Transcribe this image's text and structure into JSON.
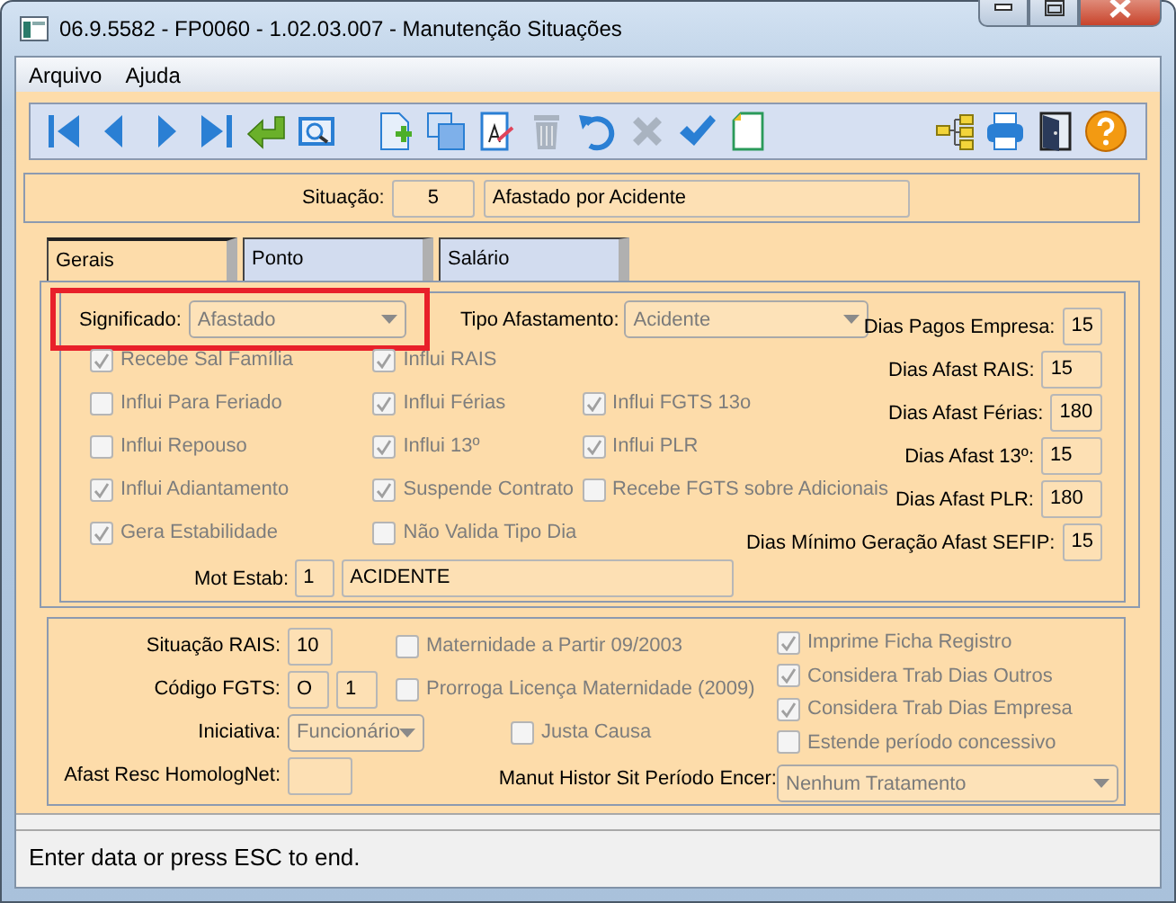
{
  "window": {
    "title": "06.9.5582 - FP0060 - 1.02.03.007 - Manutenção Situações"
  },
  "menu": [
    {
      "label": "Arquivo"
    },
    {
      "label": "Ajuda"
    }
  ],
  "toolbar": {
    "left": [
      {
        "kind": "first",
        "disabled": false
      },
      {
        "kind": "prev",
        "disabled": false
      },
      {
        "kind": "next",
        "disabled": false
      },
      {
        "kind": "last",
        "disabled": false
      },
      {
        "kind": "enter",
        "disabled": false
      },
      {
        "kind": "preview",
        "disabled": false
      },
      {
        "kind": "new",
        "disabled": false
      },
      {
        "kind": "copy",
        "disabled": false
      },
      {
        "kind": "edit",
        "disabled": false
      },
      {
        "kind": "delete",
        "disabled": true
      },
      {
        "kind": "undo",
        "disabled": false
      },
      {
        "kind": "cancel",
        "disabled": true
      },
      {
        "kind": "confirm",
        "disabled": false
      },
      {
        "kind": "note",
        "disabled": false
      }
    ],
    "right": [
      {
        "kind": "tree",
        "disabled": false
      },
      {
        "kind": "print",
        "disabled": false
      },
      {
        "kind": "exit",
        "disabled": false
      },
      {
        "kind": "help",
        "disabled": false
      }
    ]
  },
  "situacao": {
    "label": "Situação:",
    "code": "5",
    "description": "Afastado por Acidente"
  },
  "tabs": [
    {
      "label": "Gerais",
      "selected": true
    },
    {
      "label": "Ponto",
      "selected": false
    },
    {
      "label": "Salário",
      "selected": false
    }
  ],
  "gerais": {
    "significado": {
      "label": "Significado:",
      "value": "Afastado",
      "disabled": true,
      "highlighted": true
    },
    "tipo_afastamento": {
      "label": "Tipo Afastamento:",
      "value": "Acidente",
      "disabled": true
    },
    "checkbox_columns": [
      [
        {
          "label": "Recebe Sal Família",
          "checked": true,
          "disabled": true
        },
        {
          "label": "Influi Para Feriado",
          "checked": false,
          "disabled": true
        },
        {
          "label": "Influi Repouso",
          "checked": false,
          "disabled": true
        },
        {
          "label": "Influi Adiantamento",
          "checked": true,
          "disabled": true
        },
        {
          "label": "Gera Estabilidade",
          "checked": true,
          "disabled": true
        }
      ],
      [
        {
          "label": "Influi RAIS",
          "checked": true,
          "disabled": true
        },
        {
          "label": "Influi Férias",
          "checked": true,
          "disabled": true
        },
        {
          "label": "Influi 13º",
          "checked": true,
          "disabled": true
        },
        {
          "label": "Suspende Contrato",
          "checked": true,
          "disabled": true
        },
        {
          "label": "Não Valida Tipo Dia",
          "checked": false,
          "disabled": true
        }
      ],
      [
        {
          "label": "Influi FGTS 13o",
          "checked": true,
          "disabled": true
        },
        {
          "label": "Influi PLR",
          "checked": true,
          "disabled": true
        },
        {
          "label": "Recebe FGTS sobre Adicionais",
          "checked": false,
          "disabled": true
        }
      ]
    ],
    "day_fields": [
      {
        "label": "Dias Pagos Empresa:",
        "value": "15"
      },
      {
        "label": "Dias Afast RAIS:",
        "value": "15"
      },
      {
        "label": "Dias Afast Férias:",
        "value": "180"
      },
      {
        "label": "Dias Afast 13º:",
        "value": "15"
      },
      {
        "label": "Dias Afast PLR:",
        "value": "180"
      },
      {
        "label": "Dias Mínimo Geração Afast SEFIP:",
        "value": "15"
      }
    ],
    "mot_estab": {
      "label": "Mot Estab:",
      "code": "1",
      "description": "ACIDENTE"
    }
  },
  "lower": {
    "situacao_rais": {
      "label": "Situação RAIS:",
      "value": "10"
    },
    "codigo_fgts": {
      "label": "Código FGTS:",
      "values": [
        "O",
        "1"
      ]
    },
    "iniciativa": {
      "label": "Iniciativa:",
      "value": "Funcionário",
      "disabled": true
    },
    "afast_resc_homolognet": {
      "label": "Afast Resc HomologNet:"
    },
    "middle_checkboxes": [
      {
        "label": "Maternidade a Partir 09/2003",
        "checked": false,
        "disabled": true
      },
      {
        "label": "Prorroga Licença Maternidade (2009)",
        "checked": false,
        "disabled": true
      }
    ],
    "justa_causa": {
      "label": "Justa Causa",
      "checked": false,
      "disabled": true
    },
    "right_checkboxes": [
      {
        "label": "Imprime Ficha Registro",
        "checked": true,
        "disabled": true
      },
      {
        "label": "Considera Trab Dias Outros",
        "checked": true,
        "disabled": true
      },
      {
        "label": "Considera Trab Dias Empresa",
        "checked": true,
        "disabled": true
      },
      {
        "label": "Estende período concessivo",
        "checked": false,
        "disabled": true
      }
    ],
    "manut_histor": {
      "label": "Manut Histor Sit Período Encer:",
      "value": "Nenhum Tratamento",
      "disabled": true
    }
  },
  "status_bar": "Enter data or press ESC to end."
}
